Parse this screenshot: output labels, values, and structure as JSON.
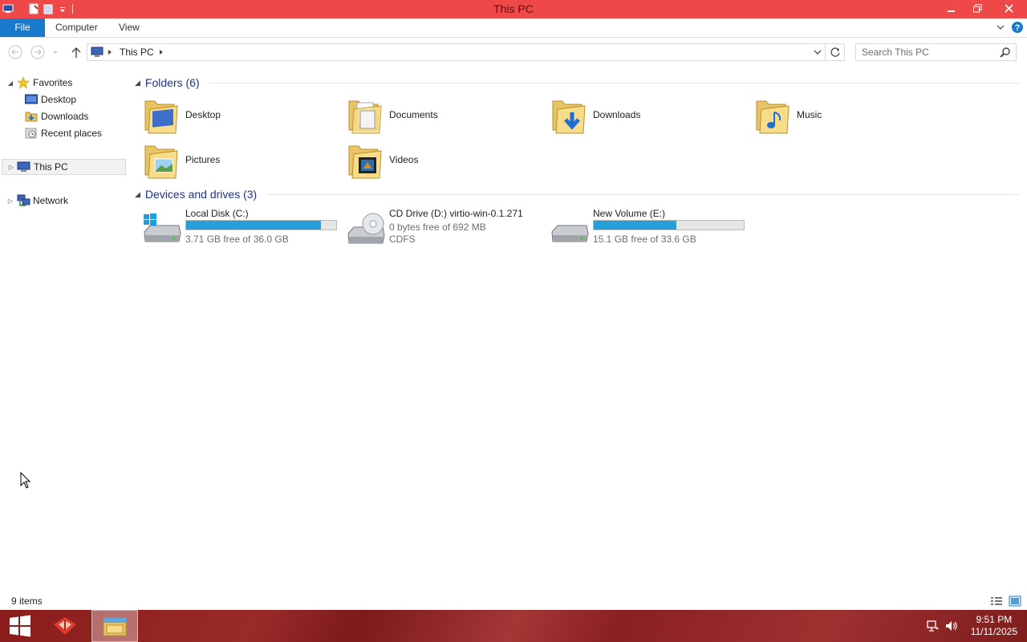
{
  "window": {
    "title": "This PC",
    "minimize_label": "—",
    "restore_label": "❐",
    "close_label": "✕"
  },
  "ribbon": {
    "tabs": [
      {
        "label": "File"
      },
      {
        "label": "Computer"
      },
      {
        "label": "View"
      }
    ]
  },
  "address": {
    "crumb": "This PC",
    "search_placeholder": "Search This PC"
  },
  "nav": {
    "favorites": "Favorites",
    "desktop": "Desktop",
    "downloads": "Downloads",
    "recent": "Recent places",
    "this_pc": "This PC",
    "network": "Network"
  },
  "groups": {
    "folders": "Folders (6)",
    "devices": "Devices and drives (3)"
  },
  "folders": [
    {
      "name": "Desktop"
    },
    {
      "name": "Documents"
    },
    {
      "name": "Downloads"
    },
    {
      "name": "Music"
    },
    {
      "name": "Pictures"
    },
    {
      "name": "Videos"
    }
  ],
  "drives": [
    {
      "name": "Local Disk (C:)",
      "free": "3.71 GB free of 36.0 GB",
      "used_fraction": 0.897
    },
    {
      "name": "CD Drive (D:) virtio-win-0.1.271",
      "free": "0 bytes free of 692 MB",
      "fs": "CDFS"
    },
    {
      "name": "New Volume (E:)",
      "free": "15.1 GB free of 33.6 GB",
      "used_fraction": 0.55
    }
  ],
  "status": {
    "count": "9 items"
  },
  "taskbar": {
    "time": "9:51 PM",
    "date": "11/11/2025"
  },
  "colors": {
    "titlebar": "#ee4848",
    "file_tab": "#1979ca",
    "drive_bar": "#26a0da"
  }
}
